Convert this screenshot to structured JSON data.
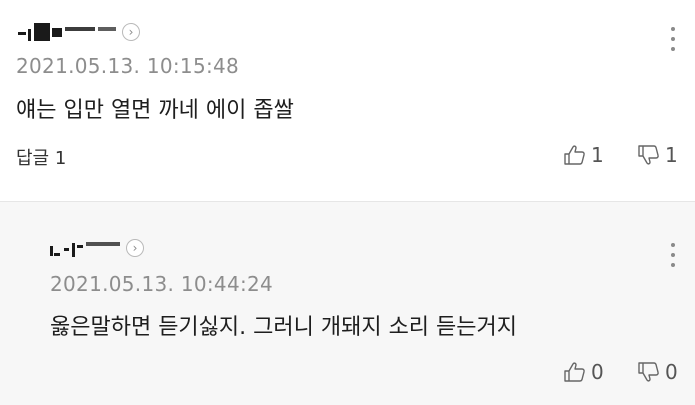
{
  "comments": [
    {
      "timestamp": "2021.05.13. 10:15:48",
      "text": "얘는 입만 열면 까네 에이 좁쌀",
      "reply_label": "답글 1",
      "likes": "1",
      "dislikes": "1",
      "author_icon": "chevron-right-icon",
      "more_icon": "more-vertical-icon"
    },
    {
      "timestamp": "2021.05.13. 10:44:24",
      "text": "옳은말하면 듣기싫지. 그러니 개돼지 소리 듣는거지",
      "likes": "0",
      "dislikes": "0",
      "author_icon": "chevron-right-icon",
      "more_icon": "more-vertical-icon"
    }
  ],
  "colors": {
    "background": "#ffffff",
    "reply_background": "#f7f7f7",
    "timestamp": "#8d8d8d",
    "text": "#1e1e1e",
    "divider": "#e6e6e6"
  }
}
